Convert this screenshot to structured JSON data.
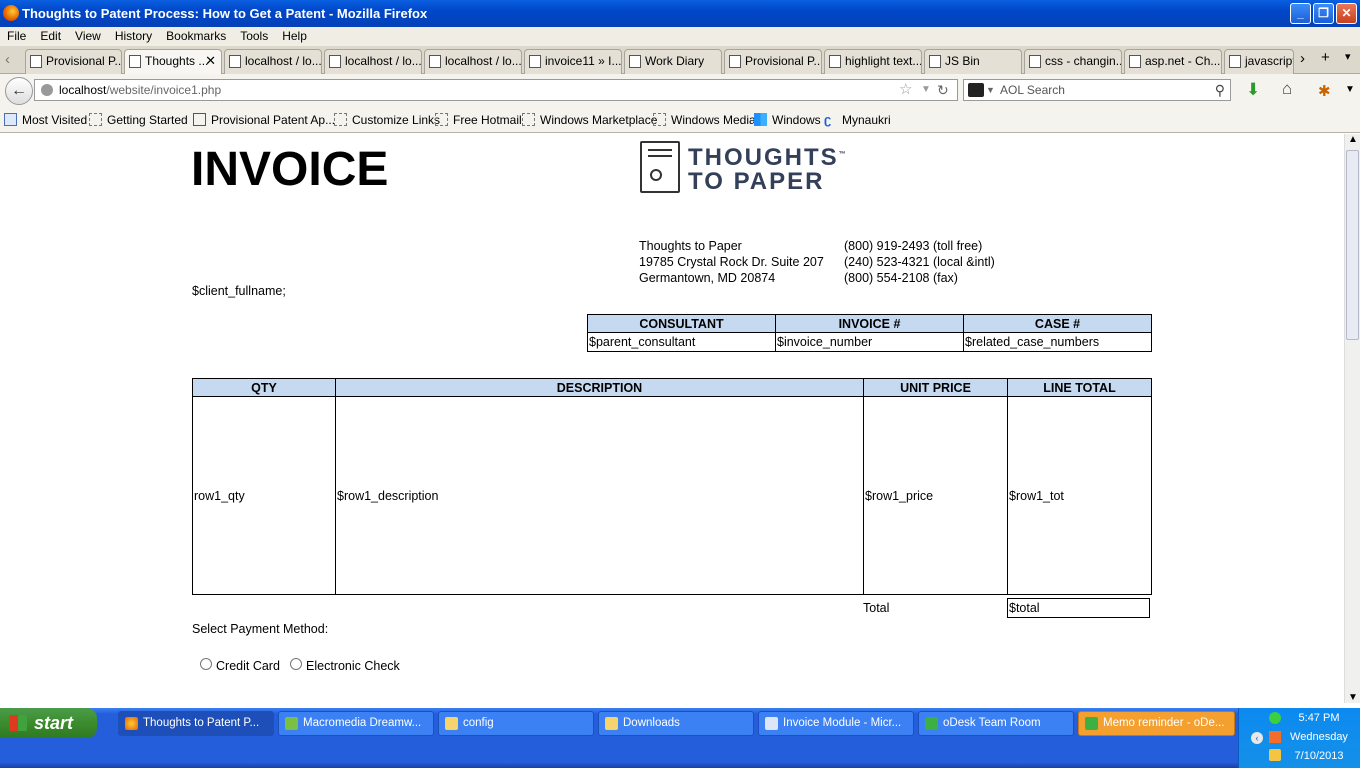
{
  "window": {
    "title": "Thoughts to Patent Process: How to Get a Patent - Mozilla Firefox"
  },
  "menu": [
    "File",
    "Edit",
    "View",
    "History",
    "Bookmarks",
    "Tools",
    "Help"
  ],
  "tabs": [
    {
      "label": "Provisional P..."
    },
    {
      "label": "Thoughts ...",
      "active": true
    },
    {
      "label": "localhost / lo..."
    },
    {
      "label": "localhost / lo..."
    },
    {
      "label": "localhost / lo..."
    },
    {
      "label": "invoice11 » I..."
    },
    {
      "label": "Work Diary"
    },
    {
      "label": "Provisional P..."
    },
    {
      "label": "highlight text..."
    },
    {
      "label": "JS Bin"
    },
    {
      "label": "css - changin..."
    },
    {
      "label": "asp.net - Ch..."
    },
    {
      "label": "javascript"
    }
  ],
  "url": {
    "host": "localhost",
    "path": "/website/invoice1.php"
  },
  "search": {
    "placeholder": "AOL Search"
  },
  "bookmarks": [
    "Most Visited",
    "Getting Started",
    "Provisional Patent Ap...",
    "Customize Links",
    "Free Hotmail",
    "Windows Marketplace",
    "Windows Media",
    "Windows",
    "Mynaukri"
  ],
  "invoice": {
    "heading": "INVOICE",
    "logo_line1": "THOUGHTS",
    "logo_line2": "TO PAPER",
    "logo_tm": "™",
    "address": [
      "Thoughts to Paper",
      "19785 Crystal Rock Dr. Suite 207",
      "Germantown, MD 20874"
    ],
    "phones": [
      "(800) 919-2493 (toll free)",
      "(240) 523-4321 (local &intl)",
      "(800) 554-2108 (fax)"
    ],
    "client": "$client_fullname;",
    "meta_headers": [
      "CONSULTANT",
      "INVOICE #",
      "CASE #"
    ],
    "meta_values": [
      "$parent_consultant",
      "$invoice_number",
      "$related_case_numbers"
    ],
    "item_headers": [
      "QTY",
      "DESCRIPTION",
      "UNIT PRICE",
      "LINE TOTAL"
    ],
    "item_row": [
      "row1_qty",
      "$row1_description",
      "$row1_price",
      "$row1_tot"
    ],
    "total_label": "Total",
    "total_value": "$total",
    "payment_label": "Select Payment Method:",
    "payment_options": [
      "Credit Card",
      "Electronic Check"
    ]
  },
  "taskbar": {
    "start": "start",
    "items": [
      {
        "label": "Thoughts to Patent P..."
      },
      {
        "label": "Macromedia Dreamw..."
      },
      {
        "label": "config"
      },
      {
        "label": "Downloads"
      },
      {
        "label": "Invoice Module - Micr..."
      },
      {
        "label": "oDesk Team Room"
      },
      {
        "label": "Memo reminder - oDe..."
      }
    ],
    "clock": {
      "time": "5:47 PM",
      "day": "Wednesday",
      "date": "7/10/2013"
    }
  }
}
